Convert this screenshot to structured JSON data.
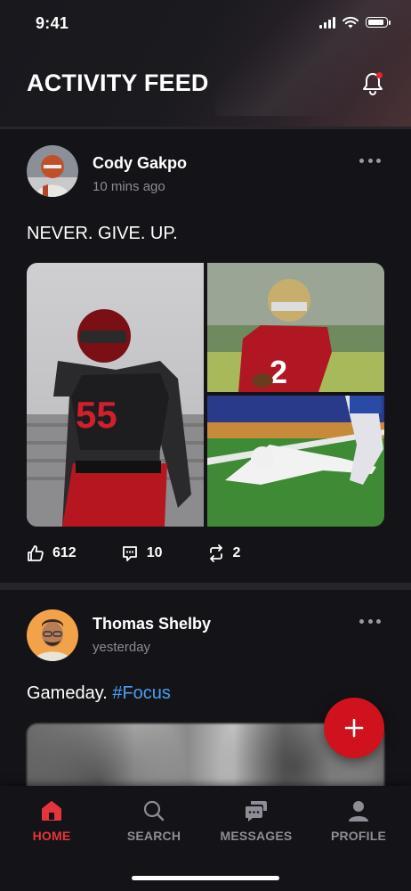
{
  "status_bar": {
    "time": "9:41"
  },
  "header": {
    "title": "ACTIVITY FEED"
  },
  "posts": [
    {
      "author": "Cody Gakpo",
      "time": "10 mins ago",
      "caption": "NEVER. GIVE. UP.",
      "likes": "612",
      "comments": "10",
      "reposts": "2"
    },
    {
      "author": "Thomas Shelby",
      "time": "yesterday",
      "caption_text": "Gameday. ",
      "caption_tag": "#Focus"
    }
  ],
  "nav": {
    "items": [
      {
        "label": "HOME",
        "icon": "home-icon",
        "active": true
      },
      {
        "label": "SEARCH",
        "icon": "search-icon",
        "active": false
      },
      {
        "label": "MESSAGES",
        "icon": "messages-icon",
        "active": false
      },
      {
        "label": "PROFILE",
        "icon": "profile-icon",
        "active": false
      }
    ]
  },
  "colors": {
    "accent": "#e5343d",
    "fab": "#d0121e",
    "background": "#141418",
    "hashtag": "#4a9ef0"
  }
}
